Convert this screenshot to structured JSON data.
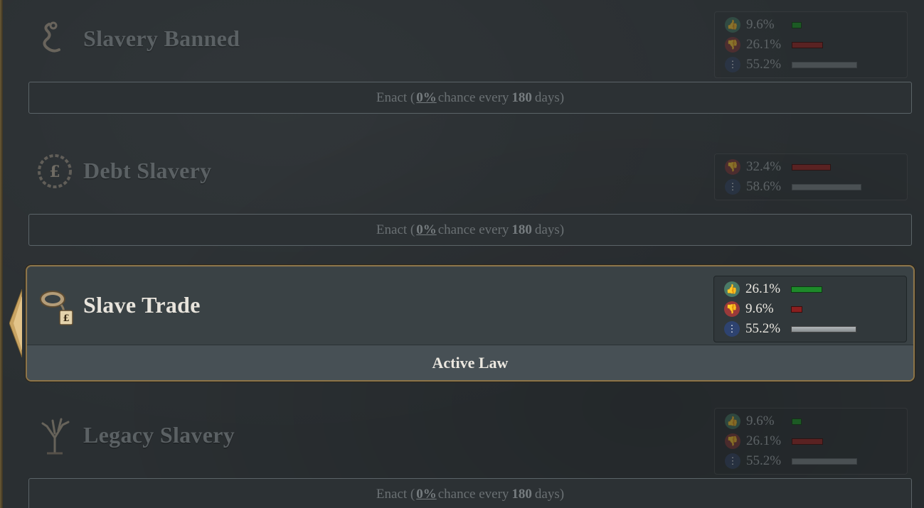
{
  "laws": [
    {
      "title": "Slavery Banned",
      "icon": "chain-icon",
      "support": [
        {
          "kind": "approve",
          "value": "9.6%",
          "bar": 0.096
        },
        {
          "kind": "disapprove",
          "value": "26.1%",
          "bar": 0.261
        },
        {
          "kind": "neutral",
          "value": "55.2%",
          "bar": 0.552
        }
      ],
      "enact": {
        "prefix": "Enact (",
        "chance": "0%",
        "middle": "chance every",
        "days": "180",
        "suffix": "days)"
      }
    },
    {
      "title": "Debt Slavery",
      "icon": "pound-chain-icon",
      "support": [
        {
          "kind": "disapprove",
          "value": "32.4%",
          "bar": 0.324
        },
        {
          "kind": "neutral",
          "value": "58.6%",
          "bar": 0.586
        }
      ],
      "enact": {
        "prefix": "Enact (",
        "chance": "0%",
        "middle": "chance every",
        "days": "180",
        "suffix": "days)"
      }
    },
    {
      "title": "Slave Trade",
      "icon": "shackle-tag-icon",
      "support": [
        {
          "kind": "approve",
          "value": "26.1%",
          "bar": 0.261
        },
        {
          "kind": "disapprove",
          "value": "9.6%",
          "bar": 0.096
        },
        {
          "kind": "neutral",
          "value": "55.2%",
          "bar": 0.552
        }
      ],
      "status": "Active Law"
    },
    {
      "title": "Legacy Slavery",
      "icon": "dead-tree-icon",
      "support": [
        {
          "kind": "approve",
          "value": "9.6%",
          "bar": 0.096
        },
        {
          "kind": "disapprove",
          "value": "26.1%",
          "bar": 0.261
        },
        {
          "kind": "neutral",
          "value": "55.2%",
          "bar": 0.552
        }
      ],
      "enact": {
        "prefix": "Enact (",
        "chance": "0%",
        "middle": "chance every",
        "days": "180",
        "suffix": "days)"
      }
    }
  ]
}
